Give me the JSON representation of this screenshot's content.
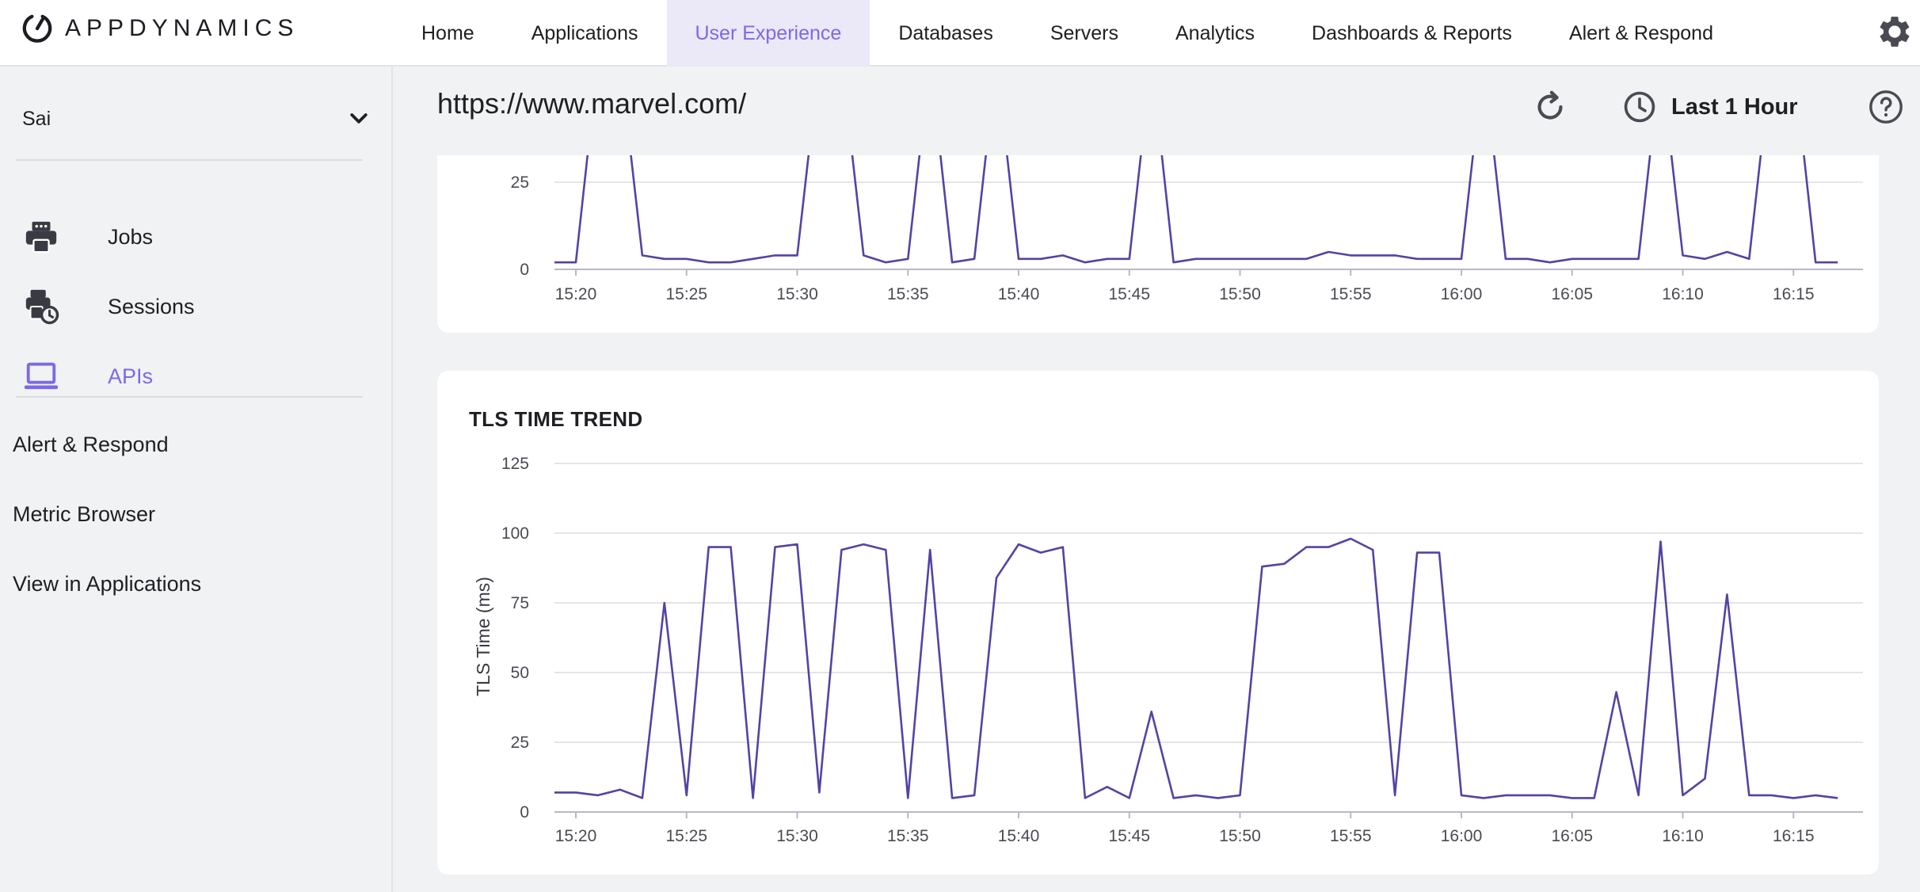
{
  "header": {
    "logo_text": "APPDYNAMICS",
    "nav": [
      {
        "label": "Home",
        "active": false
      },
      {
        "label": "Applications",
        "active": false
      },
      {
        "label": "User Experience",
        "active": true
      },
      {
        "label": "Databases",
        "active": false
      },
      {
        "label": "Servers",
        "active": false
      },
      {
        "label": "Analytics",
        "active": false
      },
      {
        "label": "Dashboards & Reports",
        "active": false
      },
      {
        "label": "Alert & Respond",
        "active": false
      }
    ],
    "settings_icon": "gear-icon"
  },
  "sidebar": {
    "app_selector": {
      "value": "Sai",
      "icon": "chevron-down-icon"
    },
    "items": [
      {
        "label": "Jobs",
        "icon": "printer-icon",
        "active": false
      },
      {
        "label": "Sessions",
        "icon": "sessions-clock-icon",
        "active": false
      },
      {
        "label": "APIs",
        "icon": "laptop-icon",
        "active": true
      }
    ],
    "links": [
      {
        "label": "Alert & Respond"
      },
      {
        "label": "Metric Browser"
      },
      {
        "label": "View in Applications"
      }
    ]
  },
  "main": {
    "title": "https://www.marvel.com/",
    "refresh_icon": "refresh-icon",
    "time_range": {
      "label": "Last 1 Hour",
      "icon": "clock-icon"
    },
    "help_icon": "help-icon"
  },
  "colors": {
    "accent": "#7b6ae6",
    "series_line": "#5443a4",
    "nav_active_bg": "#ebe8f8",
    "grid": "#e4e4ea"
  },
  "chart_data": [
    {
      "type": "line",
      "title": "",
      "xlabel": "",
      "ylabel": "",
      "x_ticks": [
        "15:20",
        "15:25",
        "15:30",
        "15:35",
        "15:40",
        "15:45",
        "15:50",
        "15:55",
        "16:00",
        "16:05",
        "16:10",
        "16:15"
      ],
      "y_ticks": [
        "0",
        "25"
      ],
      "ylim": [
        0,
        30
      ],
      "visible_range": [
        0,
        25
      ],
      "grid": true,
      "series": [
        {
          "name": "",
          "x": [
            "15:19",
            "15:20",
            "15:21",
            "15:22",
            "15:23",
            "15:24",
            "15:25",
            "15:26",
            "15:27",
            "15:28",
            "15:29",
            "15:30",
            "15:31",
            "15:32",
            "15:33",
            "15:34",
            "15:35",
            "15:36",
            "15:37",
            "15:38",
            "15:39",
            "15:40",
            "15:41",
            "15:42",
            "15:43",
            "15:44",
            "15:45",
            "15:46",
            "15:47",
            "15:48",
            "15:49",
            "15:50",
            "15:51",
            "15:52",
            "15:53",
            "15:54",
            "15:55",
            "15:56",
            "15:57",
            "15:58",
            "15:59",
            "16:00",
            "16:01",
            "16:02",
            "16:03",
            "16:04",
            "16:05",
            "16:06",
            "16:07",
            "16:08",
            "16:09",
            "16:10",
            "16:11",
            "16:12",
            "16:13",
            "16:14",
            "16:15",
            "16:16",
            "16:17"
          ],
          "values": [
            2,
            2,
            60,
            60,
            4,
            3,
            3,
            2,
            2,
            3,
            4,
            4,
            60,
            60,
            4,
            2,
            3,
            60,
            2,
            3,
            60,
            3,
            3,
            4,
            2,
            3,
            3,
            60,
            2,
            3,
            3,
            3,
            3,
            3,
            3,
            5,
            4,
            4,
            4,
            3,
            3,
            3,
            60,
            3,
            3,
            2,
            3,
            3,
            3,
            3,
            60,
            4,
            3,
            5,
            3,
            60,
            60,
            2,
            2
          ]
        }
      ]
    },
    {
      "type": "line",
      "title": "TLS TIME TREND",
      "xlabel": "",
      "ylabel": "TLS Time (ms)",
      "x_ticks": [
        "15:20",
        "15:25",
        "15:30",
        "15:35",
        "15:40",
        "15:45",
        "15:50",
        "15:55",
        "16:00",
        "16:05",
        "16:10",
        "16:15"
      ],
      "y_ticks": [
        "0",
        "25",
        "50",
        "75",
        "100",
        "125"
      ],
      "ylim": [
        0,
        125
      ],
      "grid": true,
      "series": [
        {
          "name": "",
          "x": [
            "15:19",
            "15:20",
            "15:21",
            "15:22",
            "15:23",
            "15:24",
            "15:25",
            "15:26",
            "15:27",
            "15:28",
            "15:29",
            "15:30",
            "15:31",
            "15:32",
            "15:33",
            "15:34",
            "15:35",
            "15:36",
            "15:37",
            "15:38",
            "15:39",
            "15:40",
            "15:41",
            "15:42",
            "15:43",
            "15:44",
            "15:45",
            "15:46",
            "15:47",
            "15:48",
            "15:49",
            "15:50",
            "15:51",
            "15:52",
            "15:53",
            "15:54",
            "15:55",
            "15:56",
            "15:57",
            "15:58",
            "15:59",
            "16:00",
            "16:01",
            "16:02",
            "16:03",
            "16:04",
            "16:05",
            "16:06",
            "16:07",
            "16:08",
            "16:09",
            "16:10",
            "16:11",
            "16:12",
            "16:13",
            "16:14",
            "16:15",
            "16:16",
            "16:17"
          ],
          "values": [
            7,
            7,
            6,
            8,
            5,
            75,
            6,
            95,
            95,
            5,
            95,
            96,
            7,
            94,
            96,
            94,
            5,
            94,
            5,
            6,
            84,
            96,
            93,
            95,
            5,
            9,
            5,
            36,
            5,
            6,
            5,
            6,
            88,
            89,
            95,
            95,
            98,
            94,
            6,
            93,
            93,
            6,
            5,
            6,
            6,
            6,
            5,
            5,
            43,
            6,
            97,
            6,
            12,
            78,
            6,
            6,
            5,
            6,
            5
          ]
        }
      ]
    }
  ]
}
